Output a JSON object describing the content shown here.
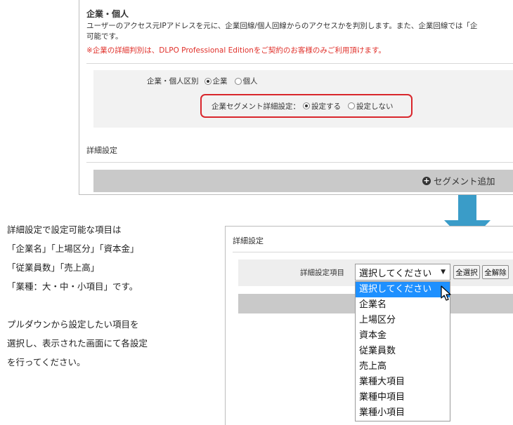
{
  "top_panel": {
    "section_title": "企業・個人",
    "description_line1": "ユーザーのアクセス元IPアドレスを元に、企業回線/個人回線からのアクセスかを判別します。また、企業回線では「企",
    "description_line2": "可能です。",
    "note": "※企業の詳細判別は、DLPO Professional Editionをご契約のお客様のみご利用頂けます。",
    "type_label": "企業・個人区別",
    "type_options": [
      {
        "label": "企業",
        "checked": true
      },
      {
        "label": "個人",
        "checked": false
      }
    ],
    "segment_label": "企業セグメント詳細設定：",
    "segment_options": [
      {
        "label": "設定する",
        "checked": true
      },
      {
        "label": "設定しない",
        "checked": false
      }
    ],
    "detail_title": "詳細設定",
    "add_segment_label": "セグメント追加",
    "highlight_color": "#d9262c"
  },
  "left_text": {
    "lines": [
      "詳細設定で設定可能な項目は",
      "「企業名」「上場区分」「資本金」",
      "「従業員数」「売上高」",
      "「業種：大・中・小項目」です。"
    ],
    "lines2": [
      "プルダウンから設定したい項目を",
      "選択し、表示された画面にて各設定",
      "を行ってください。"
    ]
  },
  "bottom_panel": {
    "title": "詳細設定",
    "field_label": "詳細設定項目",
    "select_value": "選択してください",
    "select_all_label": "全選択",
    "clear_all_label": "全解除",
    "options": [
      "選択してください",
      "企業名",
      "上場区分",
      "資本金",
      "従業員数",
      "売上高",
      "業種大項目",
      "業種中項目",
      "業種小項目"
    ],
    "selected_index": 0,
    "highlight_color": "#1e90ff"
  },
  "arrow_color": "#3a9cc8"
}
